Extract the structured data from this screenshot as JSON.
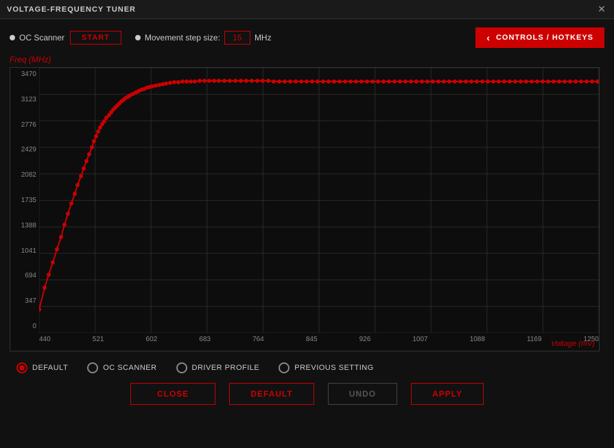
{
  "window": {
    "title": "VOLTAGE-FREQUENCY TUNER",
    "close_label": "✕"
  },
  "toolbar": {
    "oc_scanner_label": "OC Scanner",
    "start_label": "START",
    "step_label": "Movement step size:",
    "step_value": "15",
    "mhz_label": "MHz",
    "controls_label": "CONTROLS / HOTKEYS"
  },
  "chart": {
    "freq_axis_label": "Freq (MHz)",
    "voltage_axis_label": "Voltage (mV)",
    "y_labels": [
      "0",
      "347",
      "694",
      "1041",
      "1388",
      "1735",
      "2082",
      "2429",
      "2776",
      "3123",
      "3470"
    ],
    "x_labels": [
      "440",
      "521",
      "602",
      "683",
      "764",
      "845",
      "926",
      "1007",
      "1088",
      "1169",
      "1250"
    ]
  },
  "radio_options": [
    {
      "id": "default",
      "label": "DEFAULT",
      "selected": true
    },
    {
      "id": "oc_scanner",
      "label": "OC SCANNER",
      "selected": false
    },
    {
      "id": "driver_profile",
      "label": "DRIVER PROFILE",
      "selected": false
    },
    {
      "id": "previous_setting",
      "label": "PREVIOUS SETTING",
      "selected": false
    }
  ],
  "buttons": {
    "close_label": "CLOSE",
    "default_label": "DEFAULT",
    "undo_label": "UNDO",
    "apply_label": "APPLY"
  }
}
